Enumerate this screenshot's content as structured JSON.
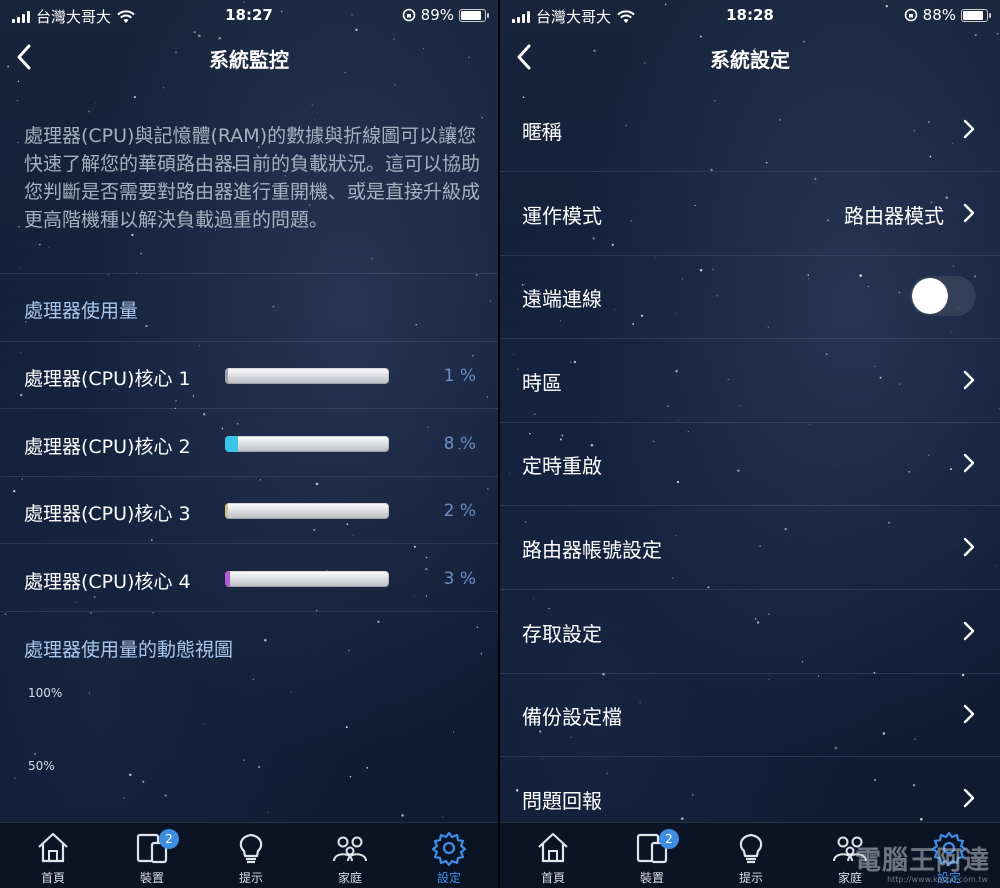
{
  "left": {
    "status": {
      "carrier": "台灣大哥大",
      "time": "18:27",
      "battery": "89%",
      "battery_level": 0.89
    },
    "nav": {
      "title": "系統監控"
    },
    "description": "處理器(CPU)與記憶體(RAM)的數據與折線圖可以讓您快速了解您的華碩路由器目前的負載狀況。這可以協助您判斷是否需要對路由器進行重開機、或是直接升級成更高階機種以解決負載過重的問題。",
    "cpu_section_title": "處理器使用量",
    "cores": [
      {
        "label": "處理器(CPU)核心 1",
        "value": 1,
        "value_text": "1 %",
        "color": "#9aa3ad"
      },
      {
        "label": "處理器(CPU)核心 2",
        "value": 8,
        "value_text": "8 %",
        "color": "#39c6e6"
      },
      {
        "label": "處理器(CPU)核心 3",
        "value": 2,
        "value_text": "2 %",
        "color": "#c9c08a"
      },
      {
        "label": "處理器(CPU)核心 4",
        "value": 3,
        "value_text": "3 %",
        "color": "#b35ad6"
      }
    ],
    "chart_section_title": "處理器使用量的動態視圖",
    "chart_ticks": [
      "100%",
      "50%"
    ],
    "tabs": [
      {
        "label": "首頁",
        "icon": "home-icon"
      },
      {
        "label": "裝置",
        "icon": "devices-icon",
        "badge": "2"
      },
      {
        "label": "提示",
        "icon": "lightbulb-icon"
      },
      {
        "label": "家庭",
        "icon": "family-icon"
      },
      {
        "label": "設定",
        "icon": "gear-icon",
        "active": true
      }
    ]
  },
  "right": {
    "status": {
      "carrier": "台灣大哥大",
      "time": "18:28",
      "battery": "88%",
      "battery_level": 0.88
    },
    "nav": {
      "title": "系統設定"
    },
    "items": [
      {
        "label": "暱稱",
        "type": "link"
      },
      {
        "label": "運作模式",
        "type": "link",
        "value": "路由器模式"
      },
      {
        "label": "遠端連線",
        "type": "toggle",
        "on": false
      },
      {
        "label": "時區",
        "type": "link"
      },
      {
        "label": "定時重啟",
        "type": "link"
      },
      {
        "label": "路由器帳號設定",
        "type": "link"
      },
      {
        "label": "存取設定",
        "type": "link"
      },
      {
        "label": "備份設定檔",
        "type": "link"
      },
      {
        "label": "問題回報",
        "type": "link"
      }
    ],
    "tabs": [
      {
        "label": "首頁",
        "icon": "home-icon"
      },
      {
        "label": "裝置",
        "icon": "devices-icon",
        "badge": "2"
      },
      {
        "label": "提示",
        "icon": "lightbulb-icon"
      },
      {
        "label": "家庭",
        "icon": "family-icon"
      },
      {
        "label": "設定",
        "icon": "gear-icon",
        "active": true
      }
    ],
    "watermark": {
      "text": "電腦王阿達",
      "url": "http://www.kocpc.com.tw"
    }
  }
}
